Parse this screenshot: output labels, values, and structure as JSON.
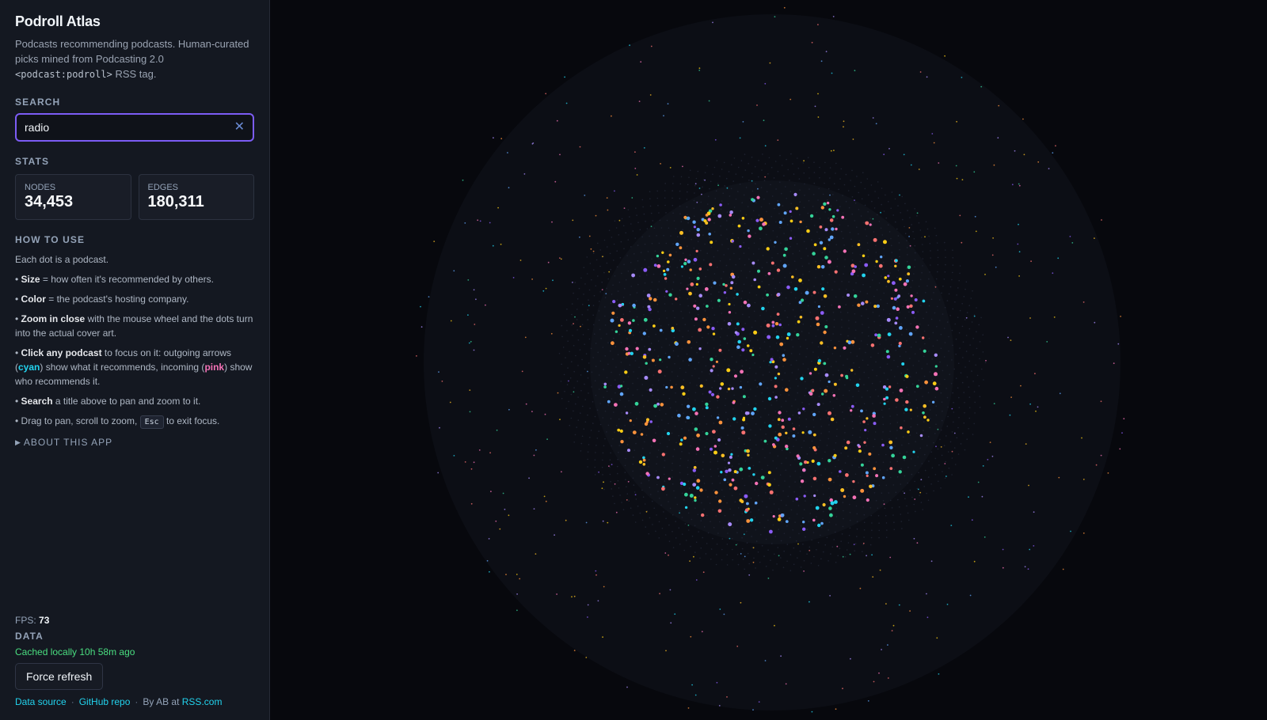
{
  "app": {
    "title": "Podroll Atlas",
    "subtitle_before": "Podcasts recommending podcasts. Human-curated picks mined from Podcasting 2.0 ",
    "subtitle_code": "<podcast:podroll>",
    "subtitle_after": " RSS tag."
  },
  "search": {
    "label": "SEARCH",
    "value": "radio",
    "clear_glyph": "✕"
  },
  "stats": {
    "label": "STATS",
    "nodes_label": "NODES",
    "nodes_value": "34,453",
    "edges_label": "EDGES",
    "edges_value": "180,311"
  },
  "howto": {
    "label": "HOW TO USE",
    "intro": "Each dot is a podcast.",
    "bullet": "•",
    "size_bold": "Size",
    "size_text": " = how often it's recommended by others.",
    "color_bold": "Color",
    "color_text": " = the podcast's hosting company.",
    "zoom_bold": "Zoom in close",
    "zoom_text": " with the mouse wheel and the dots turn into the actual cover art.",
    "click_bold": "Click any podcast",
    "click_text1": " to focus on it: outgoing arrows (",
    "click_cyan": "cyan",
    "click_text2": ") show what it recommends, incoming (",
    "click_pink": "pink",
    "click_text3": ") show who recommends it.",
    "search_bold": "Search",
    "search_text": " a title above to pan and zoom to it.",
    "drag_text1": "Drag to pan, scroll to zoom, ",
    "drag_kbd": "Esc",
    "drag_text2": " to exit focus."
  },
  "about": {
    "glyph": "▶",
    "label": "ABOUT THIS APP"
  },
  "fps": {
    "label": "FPS: ",
    "value": "73"
  },
  "data_section": {
    "label": "DATA",
    "cached": "Cached locally 10h 58m ago",
    "refresh_button": "Force refresh"
  },
  "footer": {
    "data_source": "Data source",
    "separator": "·",
    "github": "GitHub repo",
    "by_text": "By AB at ",
    "rss_link": "RSS.com"
  },
  "graph": {
    "host_colors": [
      "#a78bfa",
      "#8b5cf6",
      "#facc15",
      "#fbbf24",
      "#22d3ee",
      "#34d399",
      "#f472b6",
      "#fb923c",
      "#60a5fa",
      "#f87171"
    ],
    "background": "#07080d"
  }
}
